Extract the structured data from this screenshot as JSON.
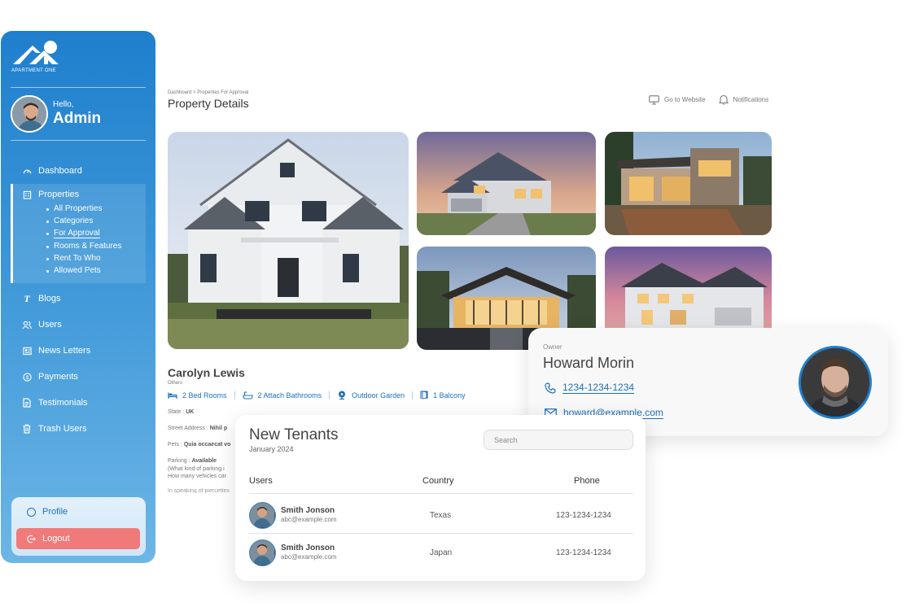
{
  "brand": {
    "name": "APARTMENT ONE"
  },
  "user": {
    "greeting": "Hello,",
    "name": "Admin"
  },
  "nav": {
    "dashboard": "Dashboard",
    "properties": "Properties",
    "sub_items": [
      "All Properties",
      "Categories",
      "For Approval",
      "Rooms & Features",
      "Rent To Who",
      "Allowed Pets"
    ],
    "blogs": "Blogs",
    "users": "Users",
    "newsletters": "News Letters",
    "payments": "Payments",
    "testimonials": "Testimonials",
    "trash": "Trash Users"
  },
  "bottom": {
    "profile": "Profile",
    "logout": "Logout"
  },
  "header": {
    "breadcrumb": "Dashboard > Properties For Approval",
    "title": "Property Details",
    "go_to_website": "Go to Website",
    "notifications": "Notifications"
  },
  "property": {
    "owner": "Carolyn Lewis",
    "category": "Others",
    "features": [
      "2 Bed Rooms",
      "2 Attach Bathrooms",
      "Outdoor Garden",
      "1 Balcony"
    ],
    "state_label": "State : ",
    "state_value": "UK",
    "street_label": "Street Address : ",
    "street_value": "Nihil p",
    "pets_label": "Pets : ",
    "pets_value": "Quia occaecat vo",
    "parking_label": "Parking : ",
    "parking_value": "Available",
    "parking_q1": "(What kind of parking i",
    "parking_q2": "How many vehicles car",
    "truncated": "In speaking of piercettes"
  },
  "owner_card": {
    "label": "Owner",
    "name": "Howard Morin",
    "phone": "1234-1234-1234",
    "email": "howard@example.com"
  },
  "tenants": {
    "title": "New Tenants",
    "subtitle": "January 2024",
    "search_placeholder": "Search",
    "columns": [
      "Users",
      "Country",
      "Phone"
    ],
    "rows": [
      {
        "name": "Smith Jonson",
        "email": "abc@example.com",
        "country": "Texas",
        "phone": "123-1234-1234"
      },
      {
        "name": "Smith Jonson",
        "email": "abc@example.com",
        "country": "Japan",
        "phone": "123-1234-1234"
      }
    ]
  },
  "colors": {
    "accent": "#1f7fcd",
    "logout": "#f07a7a",
    "link": "#1f6fb8"
  }
}
